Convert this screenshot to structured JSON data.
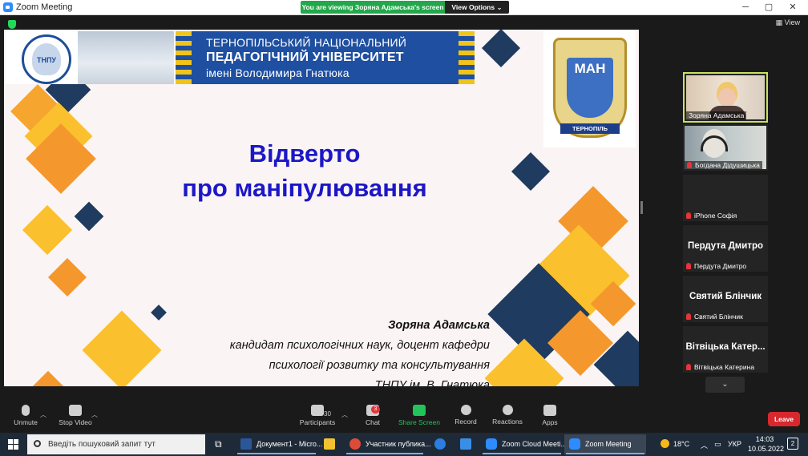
{
  "window": {
    "title": "Zoom Meeting",
    "viewing_banner": "You are viewing Зоряна Адамська's screen",
    "view_options": "View Options ⌄",
    "view_button": "View"
  },
  "slide": {
    "university": [
      "ТЕРНОПІЛЬСЬКИЙ НАЦІОНАЛЬНИЙ",
      "ПЕДАГОГІЧНИЙ УНІВЕРСИТЕТ",
      "імені Володимира Гнатюка"
    ],
    "logo_abbr": "ТНПУ",
    "badge_main": "МАН",
    "badge_city": "ТЕРНОПІЛЬ",
    "title_lines": [
      "Відверто",
      "про маніпулювання"
    ],
    "author_name": "Зоряна Адамська",
    "author_lines": [
      "кандидат психологічних наук, доцент кафедри",
      "психології розвитку та консультування",
      "ТНПУ ім. В. Гнатюка"
    ]
  },
  "gallery": [
    {
      "name": "Зоряна Адамська",
      "big": "",
      "active": true
    },
    {
      "name": "Богдана Дідушицька",
      "big": ""
    },
    {
      "name": "iPhone Софія",
      "big": ""
    },
    {
      "name": "Пердута Дмитро",
      "big": "Пердута Дмитро"
    },
    {
      "name": "Святий Блінчик",
      "big": "Святий Блінчик"
    },
    {
      "name": "Вітвіцька Катерина",
      "big": "Вітвіцька Катер..."
    }
  ],
  "controls": {
    "unmute": "Unmute",
    "stop_video": "Stop Video",
    "participants": "Participants",
    "participants_count": "30",
    "chat": "Chat",
    "chat_badge": "3",
    "share_screen": "Share Screen",
    "record": "Record",
    "reactions": "Reactions",
    "apps": "Apps",
    "leave": "Leave"
  },
  "taskbar": {
    "search_placeholder": "Введіть пошуковий запит тут",
    "apps": [
      {
        "label": "Документ1 - Micro...",
        "color": "#2b579a"
      },
      {
        "label": "",
        "color": "#f2c230"
      },
      {
        "label": "Участник публика...",
        "color": "#dd4b39"
      },
      {
        "label": "",
        "color": "#2b7de0"
      },
      {
        "label": "",
        "color": "#3a8ee6"
      },
      {
        "label": "Zoom Cloud Meeti...",
        "color": "#2d8cff"
      },
      {
        "label": "Zoom Meeting",
        "color": "#2d8cff"
      }
    ],
    "weather": "18°C",
    "language": "УКР",
    "time": "14:03",
    "date": "10.05.2022",
    "notifications": "2"
  }
}
